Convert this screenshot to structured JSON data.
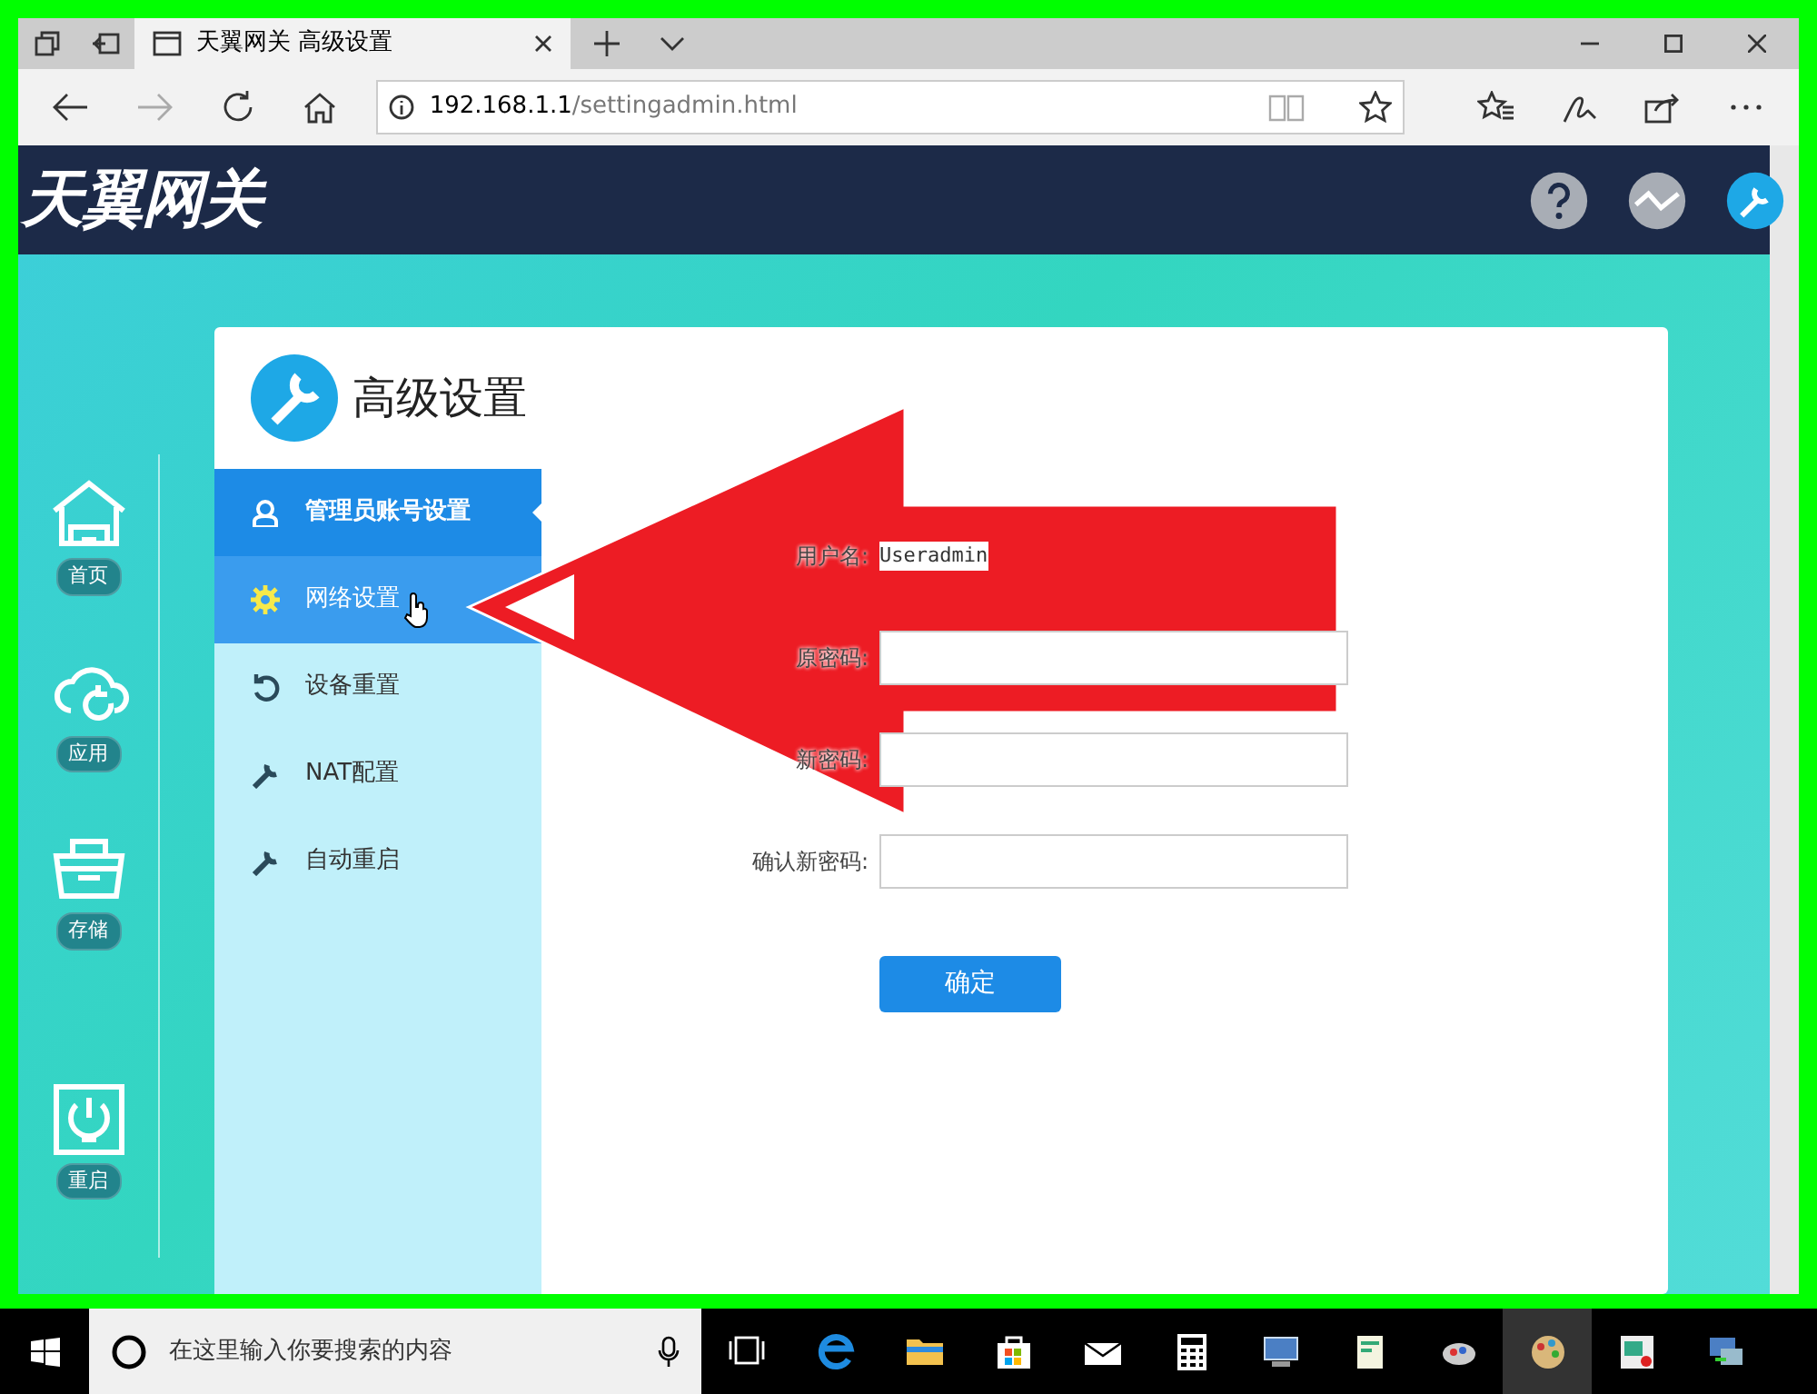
{
  "browser": {
    "tabs": [
      {
        "title": "天翼网关 高级设置",
        "selected": true
      }
    ],
    "address": {
      "host": "192.168.1.1",
      "path": "/settingadmin.html"
    }
  },
  "header": {
    "logo": "天翼网关"
  },
  "left_nav": [
    {
      "kind": "home",
      "label": "首页"
    },
    {
      "kind": "cloud",
      "label": "应用"
    },
    {
      "kind": "storage",
      "label": "存储"
    },
    {
      "kind": "power",
      "label": "重启"
    }
  ],
  "panel": {
    "title": "高级设置",
    "menu": [
      {
        "kind": "user",
        "label": "管理员账号设置",
        "selected": true,
        "hovered": false
      },
      {
        "kind": "gear",
        "label": "网络设置",
        "selected": false,
        "hovered": true
      },
      {
        "kind": "reset",
        "label": "设备重置",
        "selected": false,
        "hovered": false
      },
      {
        "kind": "wrench",
        "label": "NAT配置",
        "selected": false,
        "hovered": false
      },
      {
        "kind": "wrench",
        "label": "自动重启",
        "selected": false,
        "hovered": false
      }
    ],
    "form": [
      {
        "kind": "text",
        "label": "用户名:",
        "value": "Useradmin"
      },
      {
        "kind": "input",
        "label": "原密码:"
      },
      {
        "kind": "input",
        "label": "新密码:"
      },
      {
        "kind": "input",
        "label": "确认新密码:"
      }
    ],
    "button": "确定"
  },
  "annotation": {
    "kind": "arrow"
  },
  "taskbar": {
    "search": {
      "placeholder": "在这里输入你要搜索的内容"
    }
  }
}
